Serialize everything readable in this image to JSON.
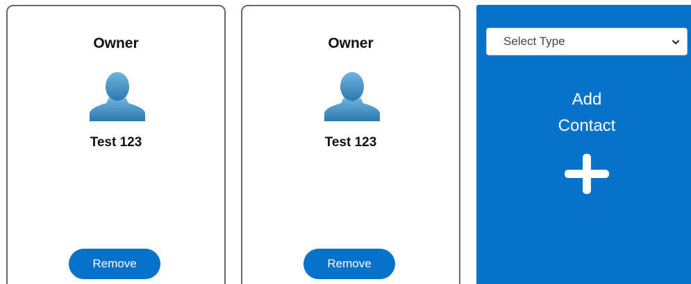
{
  "contacts": [
    {
      "role": "Owner",
      "name": "Test 123",
      "remove_label": "Remove"
    },
    {
      "role": "Owner",
      "name": "Test 123",
      "remove_label": "Remove"
    }
  ],
  "add_panel": {
    "select_placeholder": "Select Type",
    "add_label_line1": "Add",
    "add_label_line2": "Contact",
    "plus_icon": "plus-icon"
  },
  "colors": {
    "accent": "#0672c9",
    "avatar": "#3d8fc4",
    "card_border": "#666666"
  }
}
